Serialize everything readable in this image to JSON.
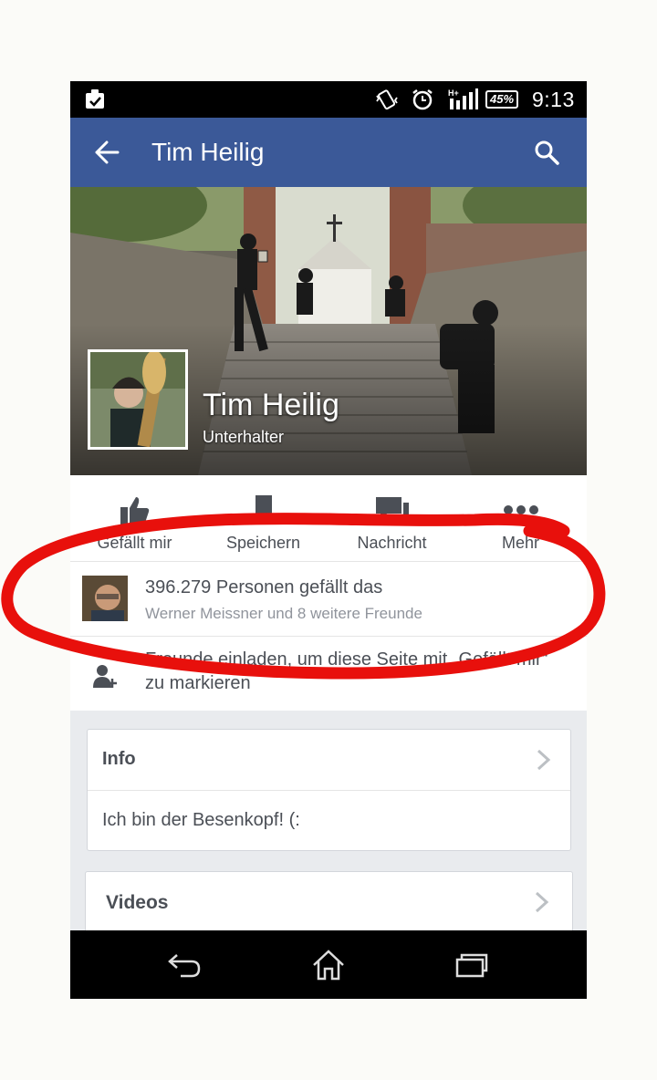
{
  "status_bar": {
    "battery": "45%",
    "time": "9:13",
    "network": "H+"
  },
  "app_bar": {
    "title": "Tim Heilig"
  },
  "page": {
    "name": "Tim Heilig",
    "category": "Unterhalter"
  },
  "actions": [
    {
      "label": "Gefällt mir",
      "icon": "thumbs-up-icon"
    },
    {
      "label": "Speichern",
      "icon": "bookmark-icon"
    },
    {
      "label": "Nachricht",
      "icon": "message-icon"
    },
    {
      "label": "Mehr",
      "icon": "more-icon"
    }
  ],
  "likes": {
    "count_text": "396.279 Personen gefällt das",
    "friends_text": "Werner Meissner und 8 weitere Freunde"
  },
  "invite": {
    "text": "Freunde einladen, um diese Seite mit „Gefällt mir“ zu markieren"
  },
  "info": {
    "title": "Info",
    "body": "Ich bin der Besenkopf! (:"
  },
  "videos": {
    "title": "Videos"
  },
  "colors": {
    "facebook_blue": "#3b5998",
    "annotation_red": "#e8100c",
    "text_primary": "#4b4f56",
    "text_secondary": "#90949c"
  }
}
